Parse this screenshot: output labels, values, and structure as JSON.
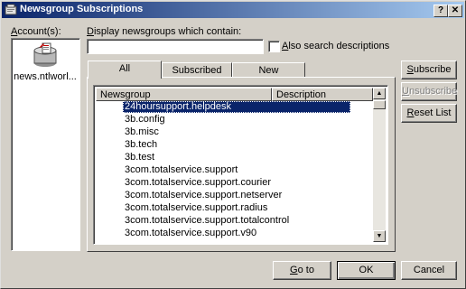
{
  "window": {
    "title": "Newsgroup Subscriptions",
    "help_glyph": "?",
    "close_glyph": "✕"
  },
  "accounts": {
    "label": "Account(s):",
    "items": [
      {
        "name": "news.ntlworl..."
      }
    ]
  },
  "filter": {
    "label": "Display newsgroups which contain:",
    "value": "",
    "also_search_label": "Also search descriptions",
    "also_search_checked": false
  },
  "tabs": [
    {
      "label": "All",
      "active": true
    },
    {
      "label": "Subscribed",
      "active": false
    },
    {
      "label": "New",
      "active": false
    }
  ],
  "list": {
    "columns": [
      "Newsgroup",
      "Description"
    ],
    "rows": [
      "24hoursupport.helpdesk",
      "3b.config",
      "3b.misc",
      "3b.tech",
      "3b.test",
      "3com.totalservice.support",
      "3com.totalservice.support.courier",
      "3com.totalservice.support.netserver",
      "3com.totalservice.support.radius",
      "3com.totalservice.support.totalcontrol",
      "3com.totalservice.support.v90"
    ],
    "selected_index": 0
  },
  "side_buttons": {
    "subscribe": "Subscribe",
    "unsubscribe": "Unsubscribe",
    "reset_list": "Reset List"
  },
  "bottom_buttons": {
    "goto": "Go to",
    "ok": "OK",
    "cancel": "Cancel"
  },
  "colors": {
    "title_start": "#0a246a",
    "title_end": "#a6caf0",
    "selection": "#0a246a",
    "face": "#d4d0c8"
  }
}
